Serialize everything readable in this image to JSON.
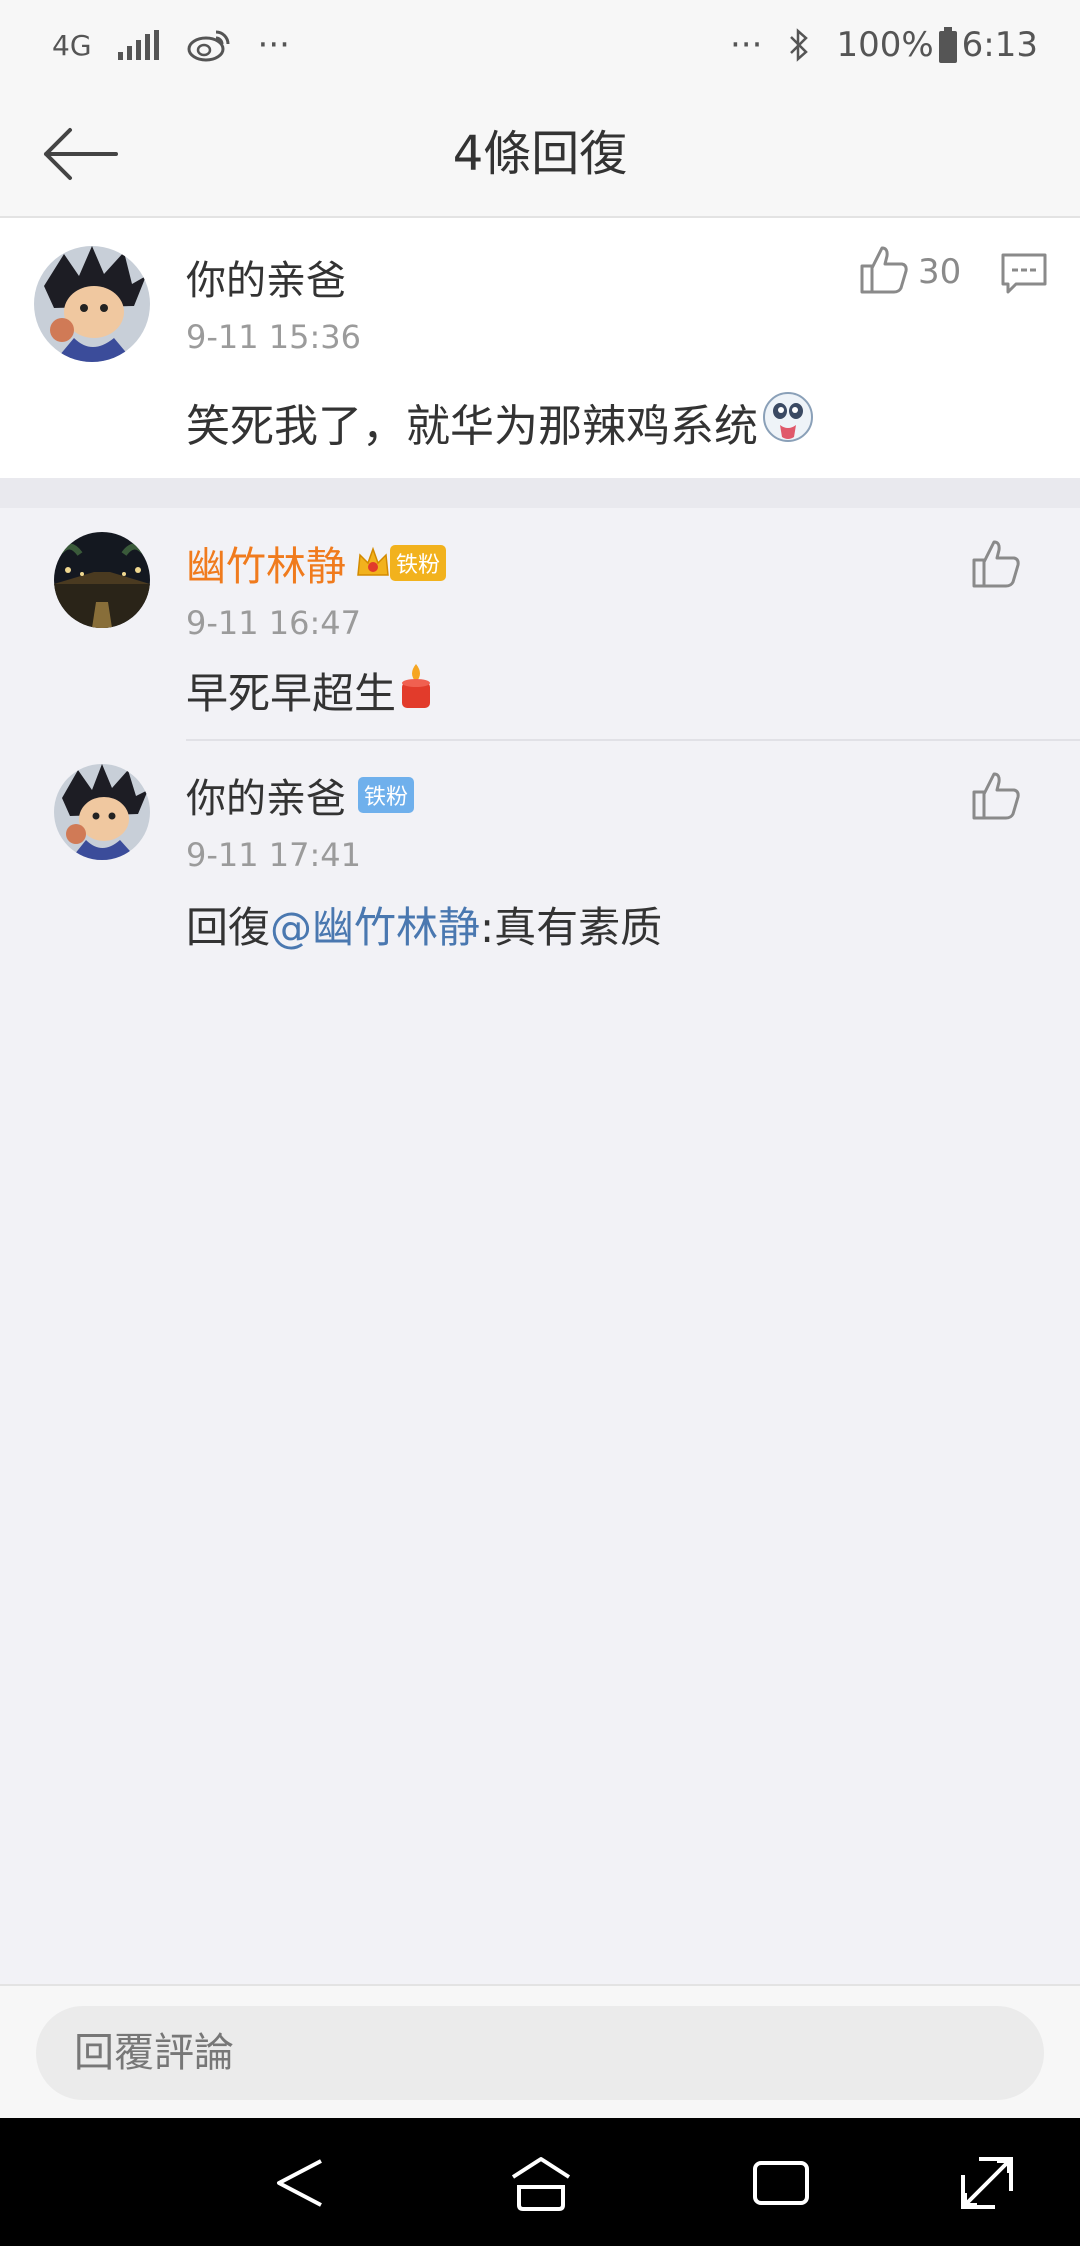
{
  "status_bar": {
    "network": "4G",
    "more_left": "···",
    "more_right": "···",
    "battery": "100%",
    "time": "6:13"
  },
  "nav": {
    "title": "4條回復"
  },
  "main_comment": {
    "username": "你的亲爸",
    "timestamp": "9-11 15:36",
    "text": "笑死我了，就华为那辣鸡系统",
    "like_count": "30"
  },
  "replies": [
    {
      "username": "幽竹林静",
      "badge": "铁粉",
      "timestamp": "9-11 16:47",
      "text": "早死早超生"
    },
    {
      "username": "你的亲爸",
      "badge": "铁粉",
      "timestamp": "9-11 17:41",
      "reply_prefix": "回復",
      "mention": "@幽竹林静",
      "text": ":真有素质"
    }
  ],
  "input": {
    "placeholder": "回覆評論"
  },
  "colors": {
    "mention": "#4a78b0",
    "vip_username": "#f07b1d",
    "badge_gold": "#f2b21d",
    "badge_blue": "#6fb0ec"
  }
}
